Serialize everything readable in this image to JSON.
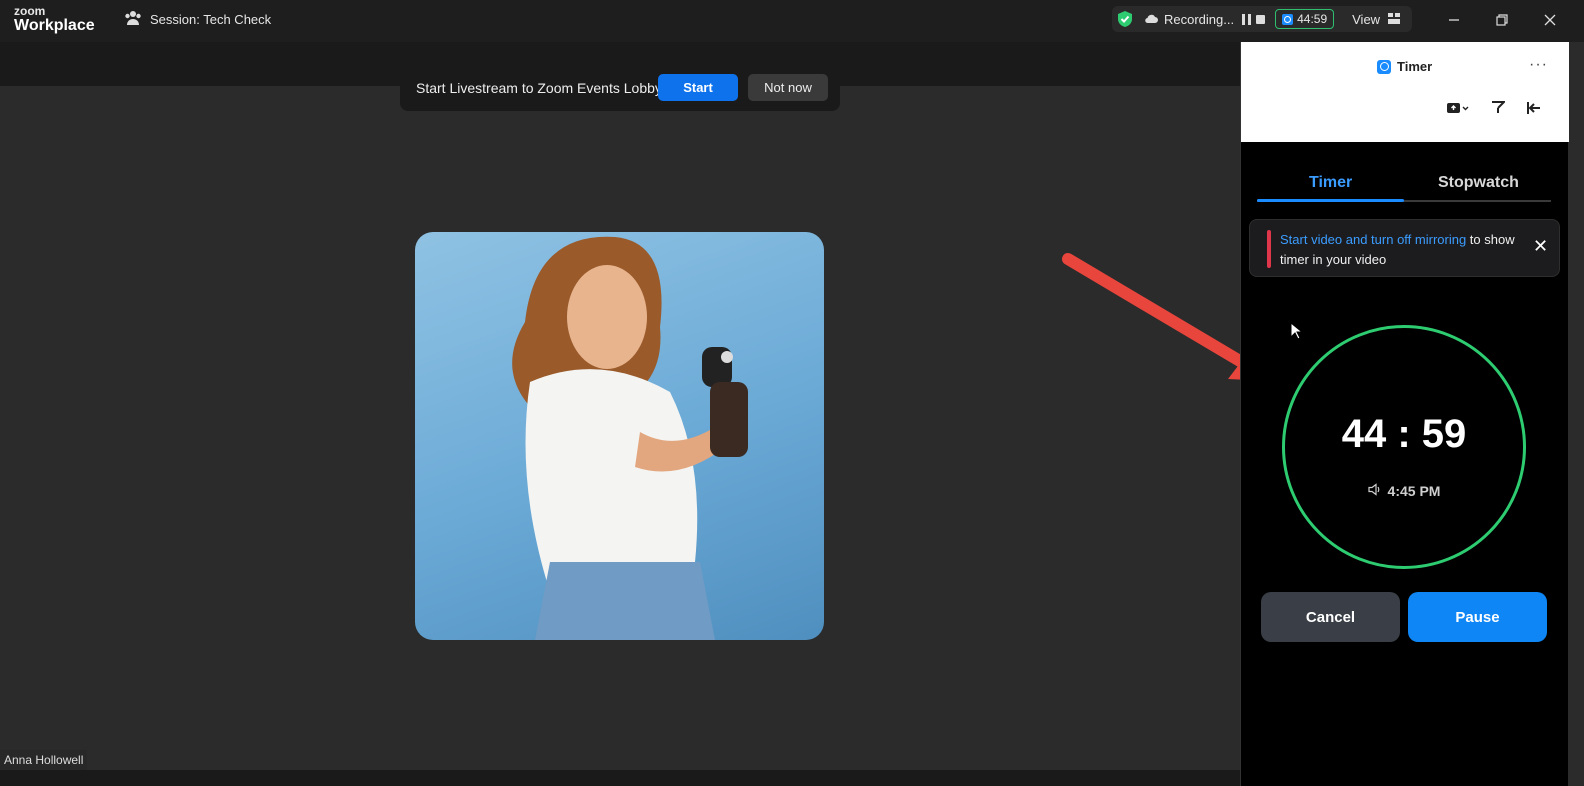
{
  "app": {
    "logo_top": "zoom",
    "logo_bottom": "Workplace",
    "session_label": "Session: Tech Check"
  },
  "status": {
    "recording_label": "Recording...",
    "timer_chip": "44:59",
    "view_label": "View"
  },
  "banner": {
    "text": "Start Livestream to Zoom Events Lobby?",
    "start_label": "Start",
    "not_now_label": "Not now"
  },
  "participant": {
    "name": "Anna Hollowell"
  },
  "panel": {
    "title": "Timer",
    "more": "···",
    "tabs": [
      {
        "label": "Timer",
        "active": true
      },
      {
        "label": "Stopwatch",
        "active": false
      }
    ],
    "notice": {
      "link_text": "Start video and turn off mirroring",
      "rest_text": " to show timer in your video"
    },
    "timer": {
      "remaining": "44 : 59",
      "end_time": "4:45 PM"
    },
    "cancel_label": "Cancel",
    "pause_label": "Pause"
  },
  "colors": {
    "accent": "#0e72ed",
    "ring": "#2ecc71",
    "notice_bar": "#e0364c",
    "arrow": "#e8453c"
  }
}
